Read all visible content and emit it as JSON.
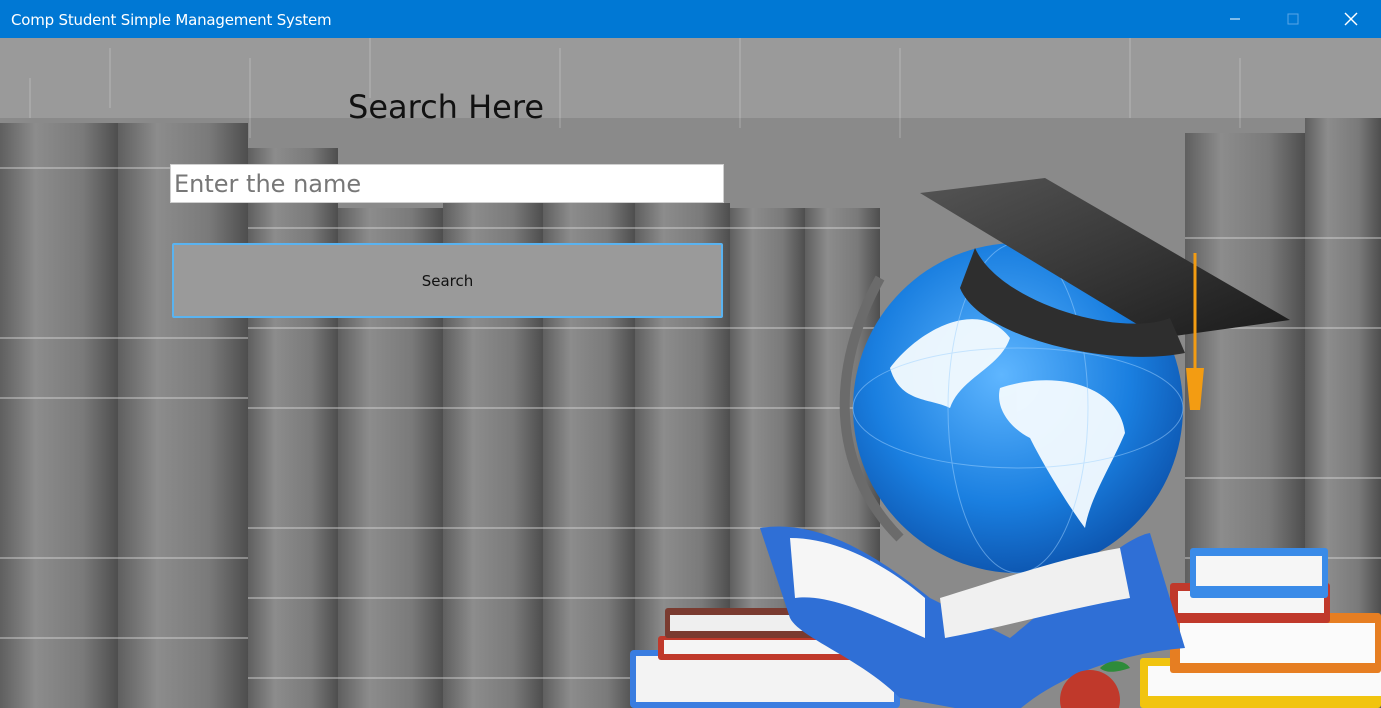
{
  "window": {
    "title": "Comp Student Simple Management System",
    "controls": [
      "minimize-icon",
      "maximize-icon",
      "close-icon"
    ],
    "titlebar_color": "#0078d4"
  },
  "main": {
    "heading": "Search Here",
    "search_input": {
      "value": "",
      "placeholder": "Enter the name"
    },
    "search_button_label": "Search"
  },
  "background": {
    "description_icons": [
      "bookshelf-image",
      "globe-icon",
      "graduation-cap-icon",
      "book-stack-icon",
      "apple-icon"
    ],
    "accent_colors": {
      "globe": "#1e88e5",
      "cap": "#2b2b2b",
      "tassel": "#f39c12",
      "book_blue": "#3f7be0",
      "book_red": "#c0392b"
    }
  }
}
